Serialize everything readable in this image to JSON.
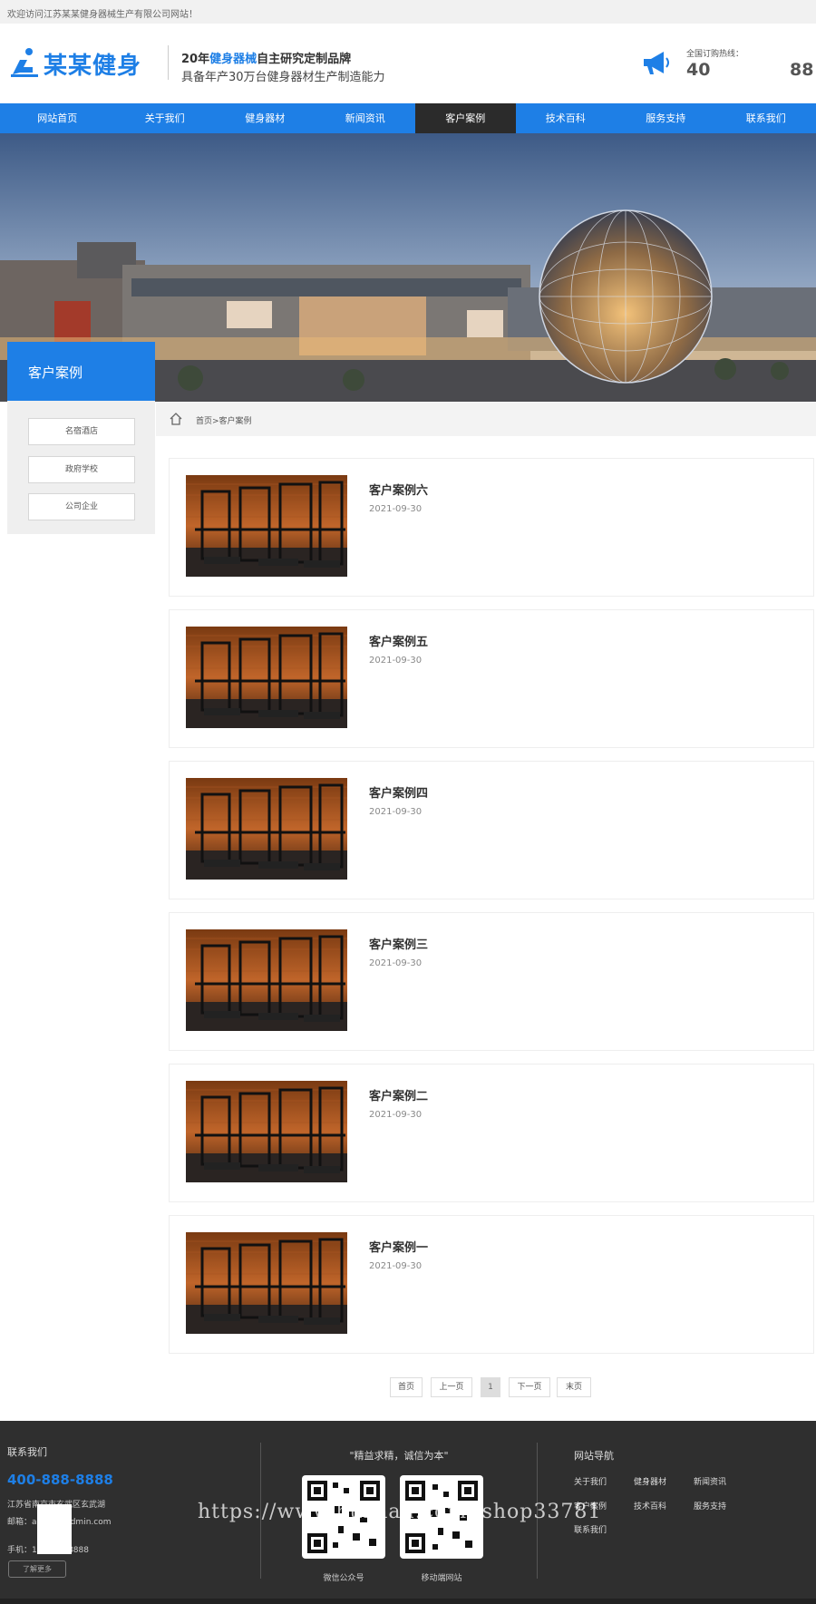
{
  "topbar": {
    "welcome": "欢迎访问江苏某某健身器械生产有限公司网站！"
  },
  "header": {
    "logo_text": "某某健身",
    "slogan_prefix": "20年",
    "slogan_highlight": "健身器械",
    "slogan_suffix": "自主研究定制品牌",
    "slogan_line2": "具备年产30万台健身器材生产制造能力",
    "hotline_label": "全国订购热线：",
    "hotline_part1": "40",
    "hotline_part2": "88"
  },
  "nav": [
    {
      "label": "网站首页",
      "active": false
    },
    {
      "label": "关于我们",
      "active": false
    },
    {
      "label": "健身器材",
      "active": false
    },
    {
      "label": "新闻资讯",
      "active": false
    },
    {
      "label": "客户案例",
      "active": true
    },
    {
      "label": "技术百科",
      "active": false
    },
    {
      "label": "服务支持",
      "active": false
    },
    {
      "label": "联系我们",
      "active": false
    }
  ],
  "sidebar": {
    "title": "客户案例",
    "items": [
      {
        "label": "名宿酒店"
      },
      {
        "label": "政府学校"
      },
      {
        "label": "公司企业"
      }
    ]
  },
  "breadcrumb": {
    "text": "首页>客户案例"
  },
  "cases": [
    {
      "title": "客户案例六",
      "date": "2021-09-30"
    },
    {
      "title": "客户案例五",
      "date": "2021-09-30"
    },
    {
      "title": "客户案例四",
      "date": "2021-09-30"
    },
    {
      "title": "客户案例三",
      "date": "2021-09-30"
    },
    {
      "title": "客户案例二",
      "date": "2021-09-30"
    },
    {
      "title": "客户案例一",
      "date": "2021-09-30"
    }
  ],
  "pager": {
    "first": "首页",
    "prev": "上一页",
    "current": "1",
    "next": "下一页",
    "last": "末页"
  },
  "footer": {
    "contact_title": "联系我们",
    "phone": "400-888-8888",
    "address": "江苏省南京市玄武区玄武湖",
    "email": "邮箱：admin@admin.com",
    "mobile": "手机：13888888888",
    "more": "了解更多",
    "quote": "\"精益求精，诚信为本\"",
    "qr1_label": "微信公众号",
    "qr2_label": "移动端网站",
    "nav_title": "网站导航",
    "nav_items": [
      "关于我们",
      "健身器材",
      "新闻资讯",
      "客户案例",
      "技术百科",
      "服务支持",
      "联系我们"
    ],
    "watermark": "https://www.huzhan.com/ishop33781"
  },
  "colors": {
    "brand": "#1e7fe6",
    "dark": "#2b2b2b",
    "footer": "#2f2f2f"
  }
}
